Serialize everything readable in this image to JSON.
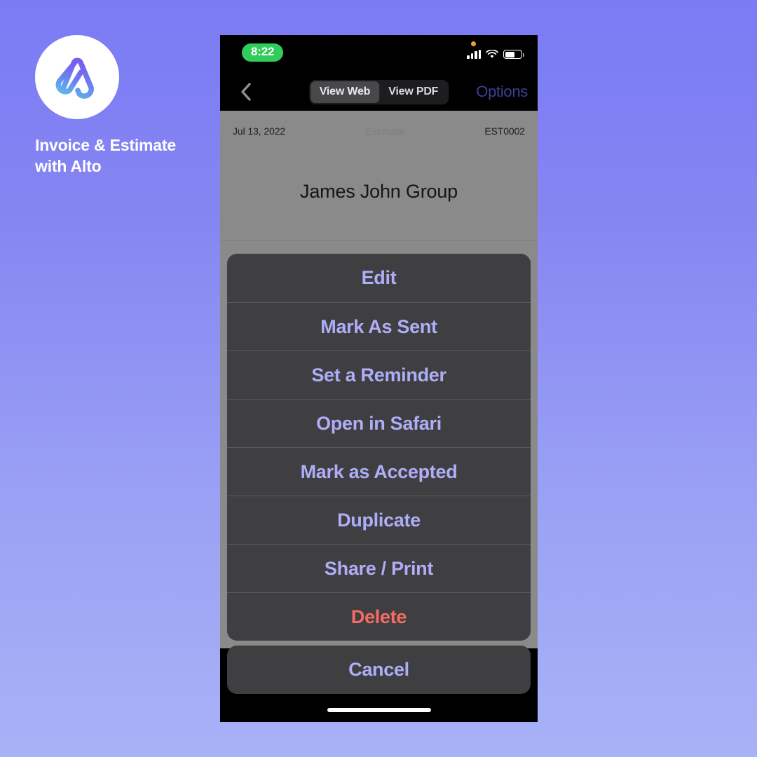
{
  "brand": {
    "logo_icon": "alto-a-logo-icon",
    "logo_gradient_from": "#7c5cf0",
    "logo_gradient_to": "#5fb4ea",
    "name": "Invoice & Estimate\nwith Alto"
  },
  "background": {
    "gradient_from": "#7b7bf5",
    "gradient_to": "#a8b2f6"
  },
  "phone": {
    "status_bar": {
      "time": "8:22",
      "time_pill_color": "#30cd5a",
      "recording_dot_color": "#f59f30",
      "cellular_icon": "signal-bars-icon",
      "wifi_icon": "wifi-icon",
      "battery_icon": "battery-icon",
      "battery_level_pct": 62
    },
    "nav_bar": {
      "back_icon": "chevron-left-icon",
      "segments": [
        {
          "label": "View Web",
          "selected": true
        },
        {
          "label": "View PDF",
          "selected": false
        }
      ],
      "options_label": "Options",
      "options_color": "#3f3f96"
    },
    "document": {
      "date": "Jul 13, 2022",
      "type": "Estimate",
      "number": "EST0002",
      "company": "James John Group"
    },
    "action_sheet": {
      "items": [
        {
          "label": "Edit",
          "style": "default"
        },
        {
          "label": "Mark As Sent",
          "style": "default"
        },
        {
          "label": "Set a Reminder",
          "style": "default"
        },
        {
          "label": "Open in Safari",
          "style": "default"
        },
        {
          "label": "Mark as Accepted",
          "style": "default"
        },
        {
          "label": "Duplicate",
          "style": "default"
        },
        {
          "label": "Share / Print",
          "style": "default"
        },
        {
          "label": "Delete",
          "style": "destructive"
        }
      ],
      "cancel_label": "Cancel",
      "default_color": "#aeaef8",
      "destructive_color": "#f76c62"
    },
    "home_indicator": "home-indicator"
  }
}
